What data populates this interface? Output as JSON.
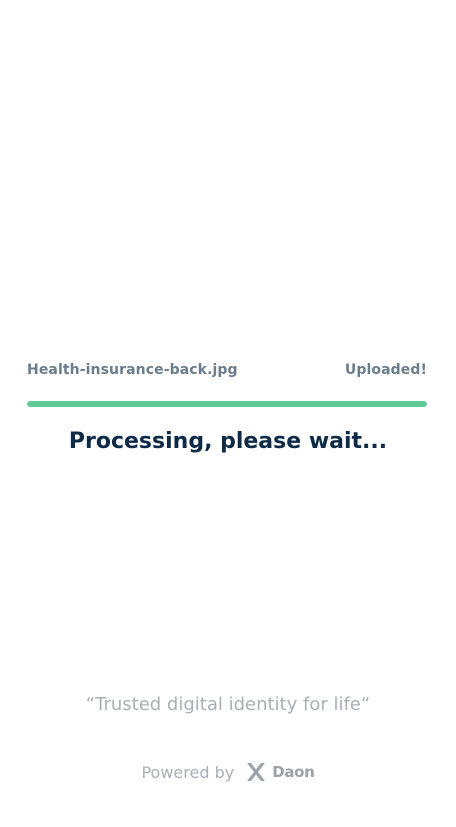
{
  "upload": {
    "file_name": "Health-insurance-back.jpg",
    "status": "Uploaded!",
    "progress_percent": 100
  },
  "message": "Processing, please wait...",
  "footer": {
    "tagline": "“Trusted digital identity for life“",
    "powered_by": "Powered by",
    "brand": "Daon",
    "brand_icon": "daon-x-logo-icon"
  },
  "colors": {
    "progress": "#5fca95",
    "heading": "#0e2a47",
    "muted": "#a9b0b8"
  }
}
